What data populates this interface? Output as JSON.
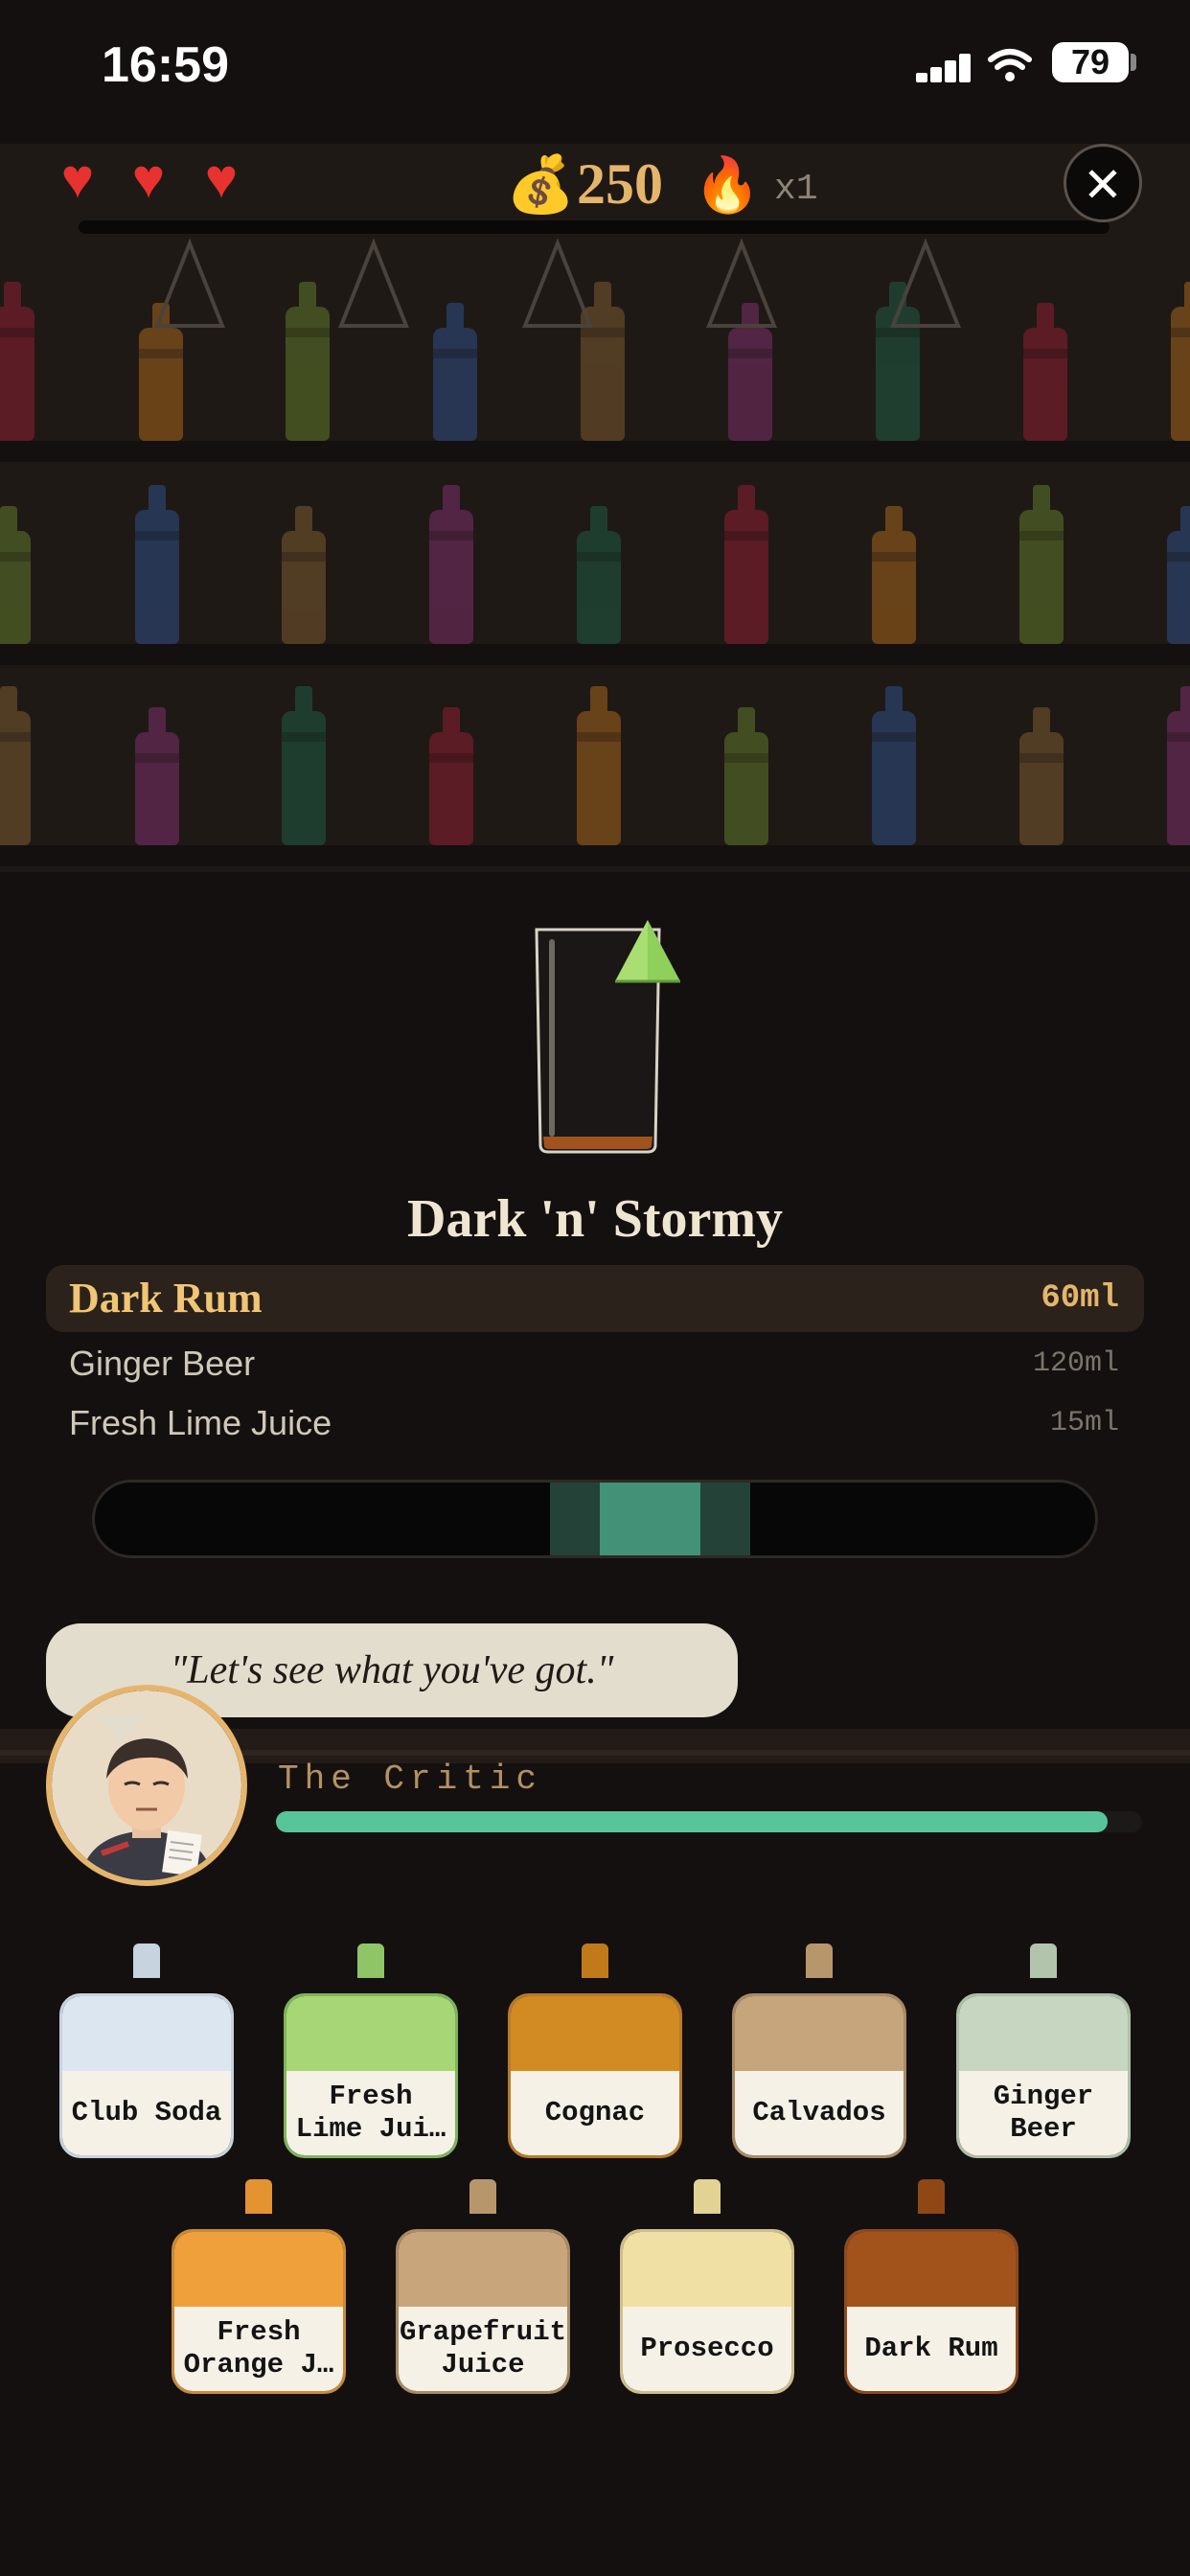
{
  "status_bar": {
    "time": "16:59",
    "battery": "79"
  },
  "hud": {
    "lives": 3,
    "coins": "250",
    "multiplier": "x1"
  },
  "drink": {
    "name": "Dark 'n' Stormy",
    "ingredients": [
      {
        "name": "Dark Rum",
        "amount": "60ml",
        "active": true
      },
      {
        "name": "Ginger Beer",
        "amount": "120ml",
        "active": false
      },
      {
        "name": "Fresh Lime Juice",
        "amount": "15ml",
        "active": false
      }
    ]
  },
  "pour_meter": {
    "target_zone": [
      0.455,
      0.655
    ],
    "sweet_spot": [
      0.505,
      0.605
    ]
  },
  "customer": {
    "quote": "\"Let's see what you've got.\"",
    "name": "The Critic",
    "patience": 0.96
  },
  "bottles_row1": [
    {
      "label": "Club Soda",
      "fill": "#dbe6f0",
      "cap": "#c7d3de",
      "border": "#c8d2dc"
    },
    {
      "label": "Fresh Lime Jui…",
      "fill": "#a6d676",
      "cap": "#8fc566",
      "border": "#7fb45a"
    },
    {
      "label": "Cognac",
      "fill": "#d28a22",
      "cap": "#c07a1a",
      "border": "#b87a2a"
    },
    {
      "label": "Calvados",
      "fill": "#c6a57c",
      "cap": "#b8966c",
      "border": "#a98b66"
    },
    {
      "label": "Ginger Beer",
      "fill": "#c6d6c0",
      "cap": "#b2c4ac",
      "border": "#aebfa8"
    }
  ],
  "bottles_row2": [
    {
      "label": "Fresh Orange J…",
      "fill": "#f0a03a",
      "cap": "#e39330",
      "border": "#c98a38"
    },
    {
      "label": "Grapefruit Juice",
      "fill": "#c9a57c",
      "cap": "#b8966c",
      "border": "#a98b66"
    },
    {
      "label": "Prosecco",
      "fill": "#f0e0a4",
      "cap": "#e2d294",
      "border": "#cdbf8c"
    },
    {
      "label": "Dark Rum",
      "fill": "#a2531b",
      "cap": "#8f4716",
      "border": "#8b4a20"
    }
  ]
}
